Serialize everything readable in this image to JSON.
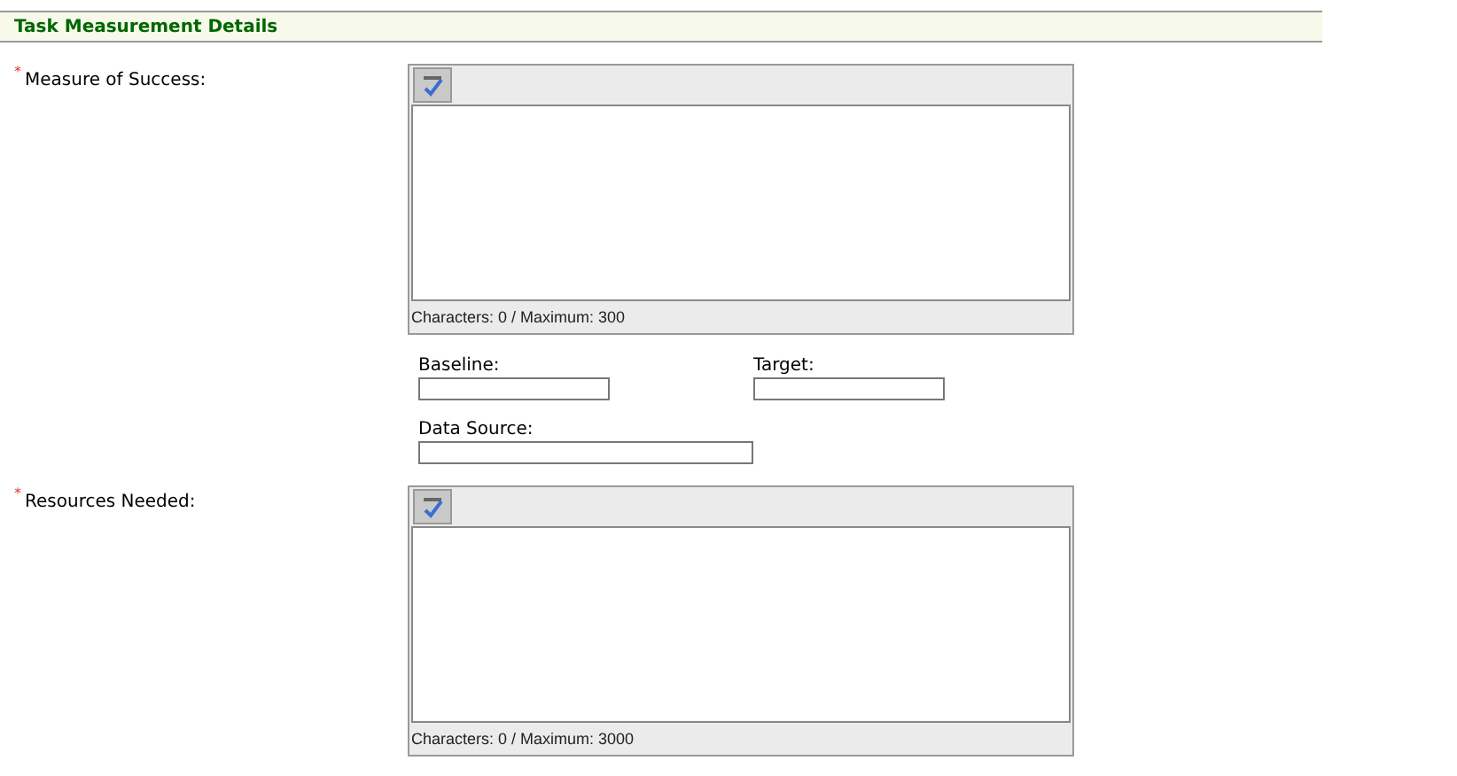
{
  "section": {
    "title": "Task Measurement Details"
  },
  "measure_of_success": {
    "required_mark": "*",
    "label": "Measure of Success:",
    "counter": "Characters: 0 / Maximum: 300"
  },
  "small_fields": [
    {
      "label": "Baseline:"
    },
    {
      "label": "Target:"
    },
    {
      "label": "Data Source:"
    }
  ],
  "resources_needed": {
    "required_mark": "*",
    "label": "Resources Needed:",
    "counter": "Characters: 0 / Maximum: 3000"
  }
}
